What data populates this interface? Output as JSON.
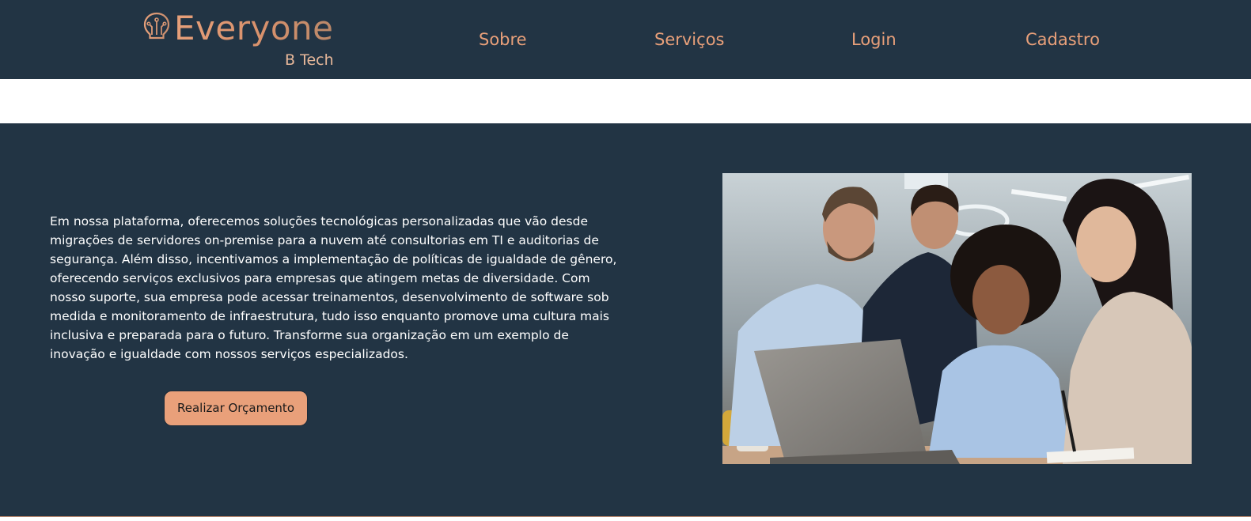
{
  "header": {
    "logo_text": "Everyone",
    "logo_subtext": "B Tech",
    "nav": [
      {
        "label": "Sobre"
      },
      {
        "label": "Serviços"
      },
      {
        "label": "Login"
      },
      {
        "label": "Cadastro"
      }
    ]
  },
  "hero": {
    "description": "Em nossa plataforma, oferecemos soluções tecnológicas personalizadas que vão desde migrações de servidores on-premise para a nuvem até consultorias em TI e auditorias de segurança. Além disso, incentivamos a implementação de políticas de igualdade de gênero, oferecendo serviços exclusivos para empresas que atingem metas de diversidade. Com nosso suporte, sua empresa pode acessar treinamentos, desenvolvimento de software sob medida e monitoramento de infraestrutura, tudo isso enquanto promove uma cultura mais inclusiva e preparada para o futuro. Transforme sua organização em um exemplo de inovação e igualdade com nossos serviços especializados.",
    "cta_label": "Realizar Orçamento"
  },
  "icons": {
    "logo": "lightbulb-circuit-icon"
  },
  "colors": {
    "navy": "#223444",
    "accent": "#e9a07a",
    "text_light": "#ffffff"
  }
}
